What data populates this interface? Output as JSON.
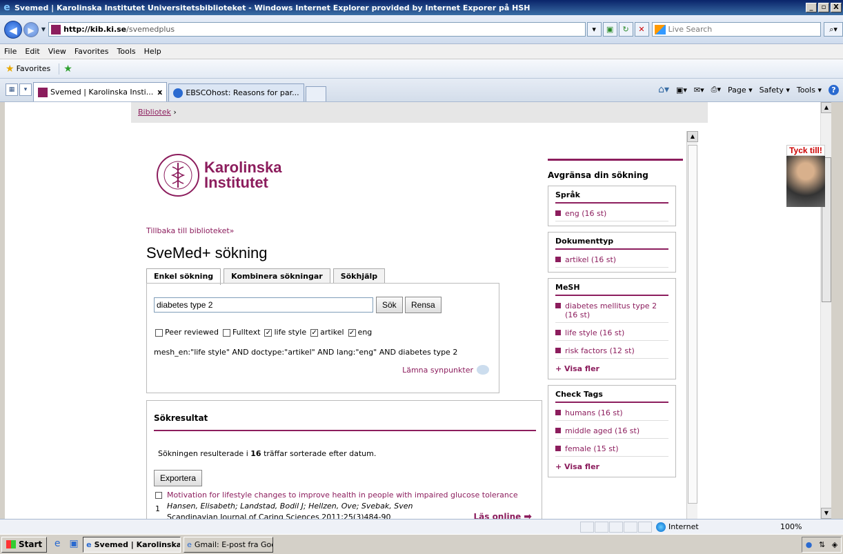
{
  "window": {
    "title": "Svemed | Karolinska Institutet Universitetsbiblioteket - Windows Internet Explorer provided by Internet Exporer på HSH",
    "minimize": "_",
    "maximize": "▫",
    "close": "X"
  },
  "address": {
    "url_host": "http://kib.ki.se",
    "url_path": "/svemedplus",
    "search_placeholder": "Live Search"
  },
  "menu": [
    "File",
    "Edit",
    "View",
    "Favorites",
    "Tools",
    "Help"
  ],
  "favorites": {
    "label": "Favorites"
  },
  "tabs": [
    {
      "label": "Svemed | Karolinska Insti...",
      "close": "x"
    },
    {
      "label": "EBSCOhost: Reasons for par..."
    }
  ],
  "command_bar": {
    "page": "Page ▾",
    "safety": "Safety ▾",
    "tools": "Tools ▾"
  },
  "breadcrumb": {
    "link": "Bibliotek",
    "sep": "›"
  },
  "logo": {
    "line1": "Karolinska",
    "line2": "Institutet"
  },
  "back_link": "Tillbaka till biblioteket»",
  "page_title": "SveMed+ sökning",
  "search_tabs": [
    "Enkel sökning",
    "Kombinera sökningar",
    "Sökhjälp"
  ],
  "search": {
    "query": "diabetes type 2",
    "search_button": "Sök",
    "clear_button": "Rensa",
    "filters": [
      {
        "label": "Peer reviewed",
        "checked": false
      },
      {
        "label": "Fulltext",
        "checked": false
      },
      {
        "label": "life style",
        "checked": true
      },
      {
        "label": "artikel",
        "checked": true
      },
      {
        "label": "eng",
        "checked": true
      }
    ],
    "query_string": "mesh_en:\"life style\" AND doctype:\"artikel\" AND lang:\"eng\" AND diabetes type 2",
    "feedback": "Lämna synpunkter"
  },
  "results": {
    "title": "Sökresultat",
    "summary_pre": "Sökningen resulterade i ",
    "summary_count": "16",
    "summary_post": " träffar sorterade efter datum.",
    "export_button": "Exportera",
    "items": [
      {
        "num": "1",
        "title": "Motivation for lifestyle changes to improve health in people with impaired glucose tolerance",
        "authors": "Hansen, Elisabeth; Landstad, Bodil J; Hellzen, Ove; Svebak, Sven",
        "journal": "Scandinavian Journal of Caring Sciences 2011;25(3)484-90",
        "read_online": "Läs online"
      }
    ]
  },
  "sidebar": {
    "heading": "Avgränsa din sökning",
    "facets": [
      {
        "title": "Språk",
        "items": [
          "eng (16 st)"
        ],
        "more": ""
      },
      {
        "title": "Dokumenttyp",
        "items": [
          "artikel (16 st)"
        ],
        "more": ""
      },
      {
        "title": "MeSH",
        "items": [
          "diabetes mellitus type 2 (16 st)",
          "life style (16 st)",
          "risk factors (12 st)"
        ],
        "more": "+ Visa fler"
      },
      {
        "title": "Check Tags",
        "items": [
          "humans (16 st)",
          "middle aged (16 st)",
          "female (15 st)"
        ],
        "more": "+ Visa fler"
      }
    ]
  },
  "tyck_till": "Tyck till!",
  "status": {
    "zone": "Internet",
    "zoom": "100%"
  },
  "taskbar": {
    "start": "Start",
    "tasks": [
      "Svemed | Karolinska ...",
      "Gmail: E-post fra Google ..."
    ]
  },
  "colors": {
    "accent": "#8c1d5d",
    "title_bar": "#0a246a"
  }
}
